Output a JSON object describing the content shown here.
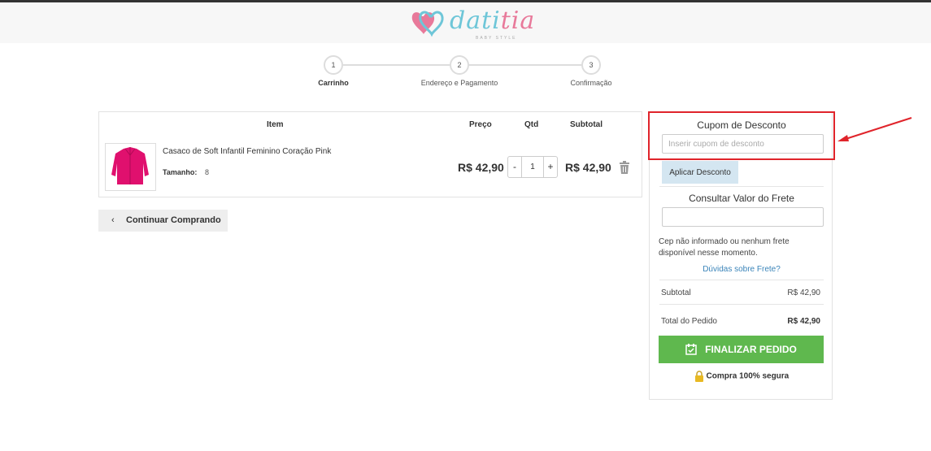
{
  "brand": {
    "name_part1": "dati",
    "name_part2": "tia",
    "tagline": "BABY STYLE"
  },
  "steps": [
    {
      "number": "1",
      "label": "Carrinho",
      "active": true
    },
    {
      "number": "2",
      "label": "Endereço e Pagamento",
      "active": false
    },
    {
      "number": "3",
      "label": "Confirmação",
      "active": false
    }
  ],
  "cart": {
    "headers": {
      "item": "Item",
      "price": "Preço",
      "qty": "Qtd",
      "subtotal": "Subtotal"
    },
    "items": [
      {
        "name": "Casaco de Soft Infantil Feminino Coração Pink",
        "size_label": "Tamanho:",
        "size_value": "8",
        "price": "R$ 42,90",
        "qty": "1",
        "qty_minus": "-",
        "qty_plus": "+",
        "subtotal": "R$ 42,90"
      }
    ],
    "continue_label": "Continuar Comprando"
  },
  "sidebar": {
    "coupon_title": "Cupom de Desconto",
    "coupon_placeholder": "Inserir cupom de desconto",
    "coupon_value": "",
    "apply_label": "Aplicar Desconto",
    "shipping_title": "Consultar Valor do Frete",
    "shipping_value": "",
    "shipping_message": "Cep não informado ou nenhum frete disponível nesse momento.",
    "shipping_faq": "Dúvidas sobre Frete?",
    "subtotal_label": "Subtotal",
    "subtotal_value": "R$ 42,90",
    "total_label": "Total do Pedido",
    "total_value": "R$ 42,90",
    "finalize_label": "FINALIZAR PEDIDO",
    "secure_label": "Compra 100% segura"
  },
  "colors": {
    "primary_green": "#5fb84e",
    "highlight_red": "#e0242b",
    "link_blue": "#3a84b9",
    "apply_bg": "#d4e6f1",
    "product_pink": "#e0106e"
  },
  "icons": [
    "heart-logo-icon",
    "chevron-left-icon",
    "trash-icon",
    "calendar-check-icon",
    "lock-icon",
    "annotation-arrow-icon"
  ]
}
